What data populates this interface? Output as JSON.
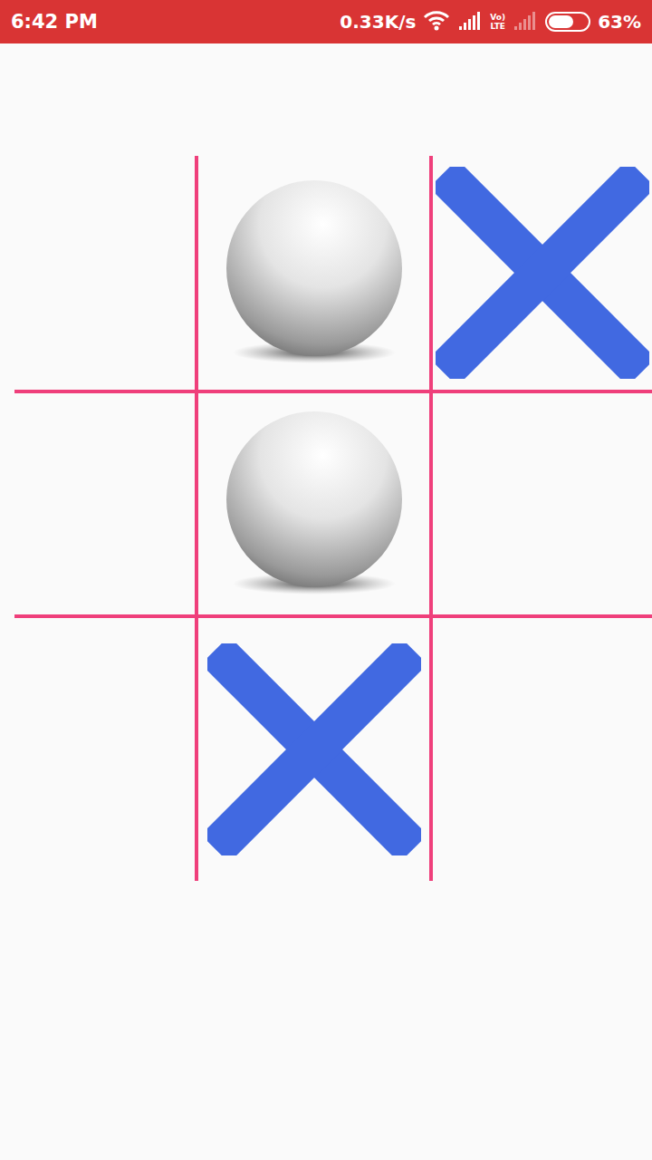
{
  "status_bar": {
    "time": "6:42 PM",
    "speed": "0.33K/s",
    "volte": {
      "top": "Vo)",
      "bottom": "LTE"
    },
    "battery": {
      "level": 0.63,
      "reading": "63%"
    }
  },
  "board": {
    "cells": [
      [
        {
          "kind": "empty"
        },
        {
          "kind": "ball"
        },
        {
          "kind": "cross"
        }
      ],
      [
        {
          "kind": "empty"
        },
        {
          "kind": "ball"
        },
        {
          "kind": "empty"
        }
      ],
      [
        {
          "kind": "empty"
        },
        {
          "kind": "cross"
        },
        {
          "kind": "empty"
        }
      ]
    ]
  }
}
